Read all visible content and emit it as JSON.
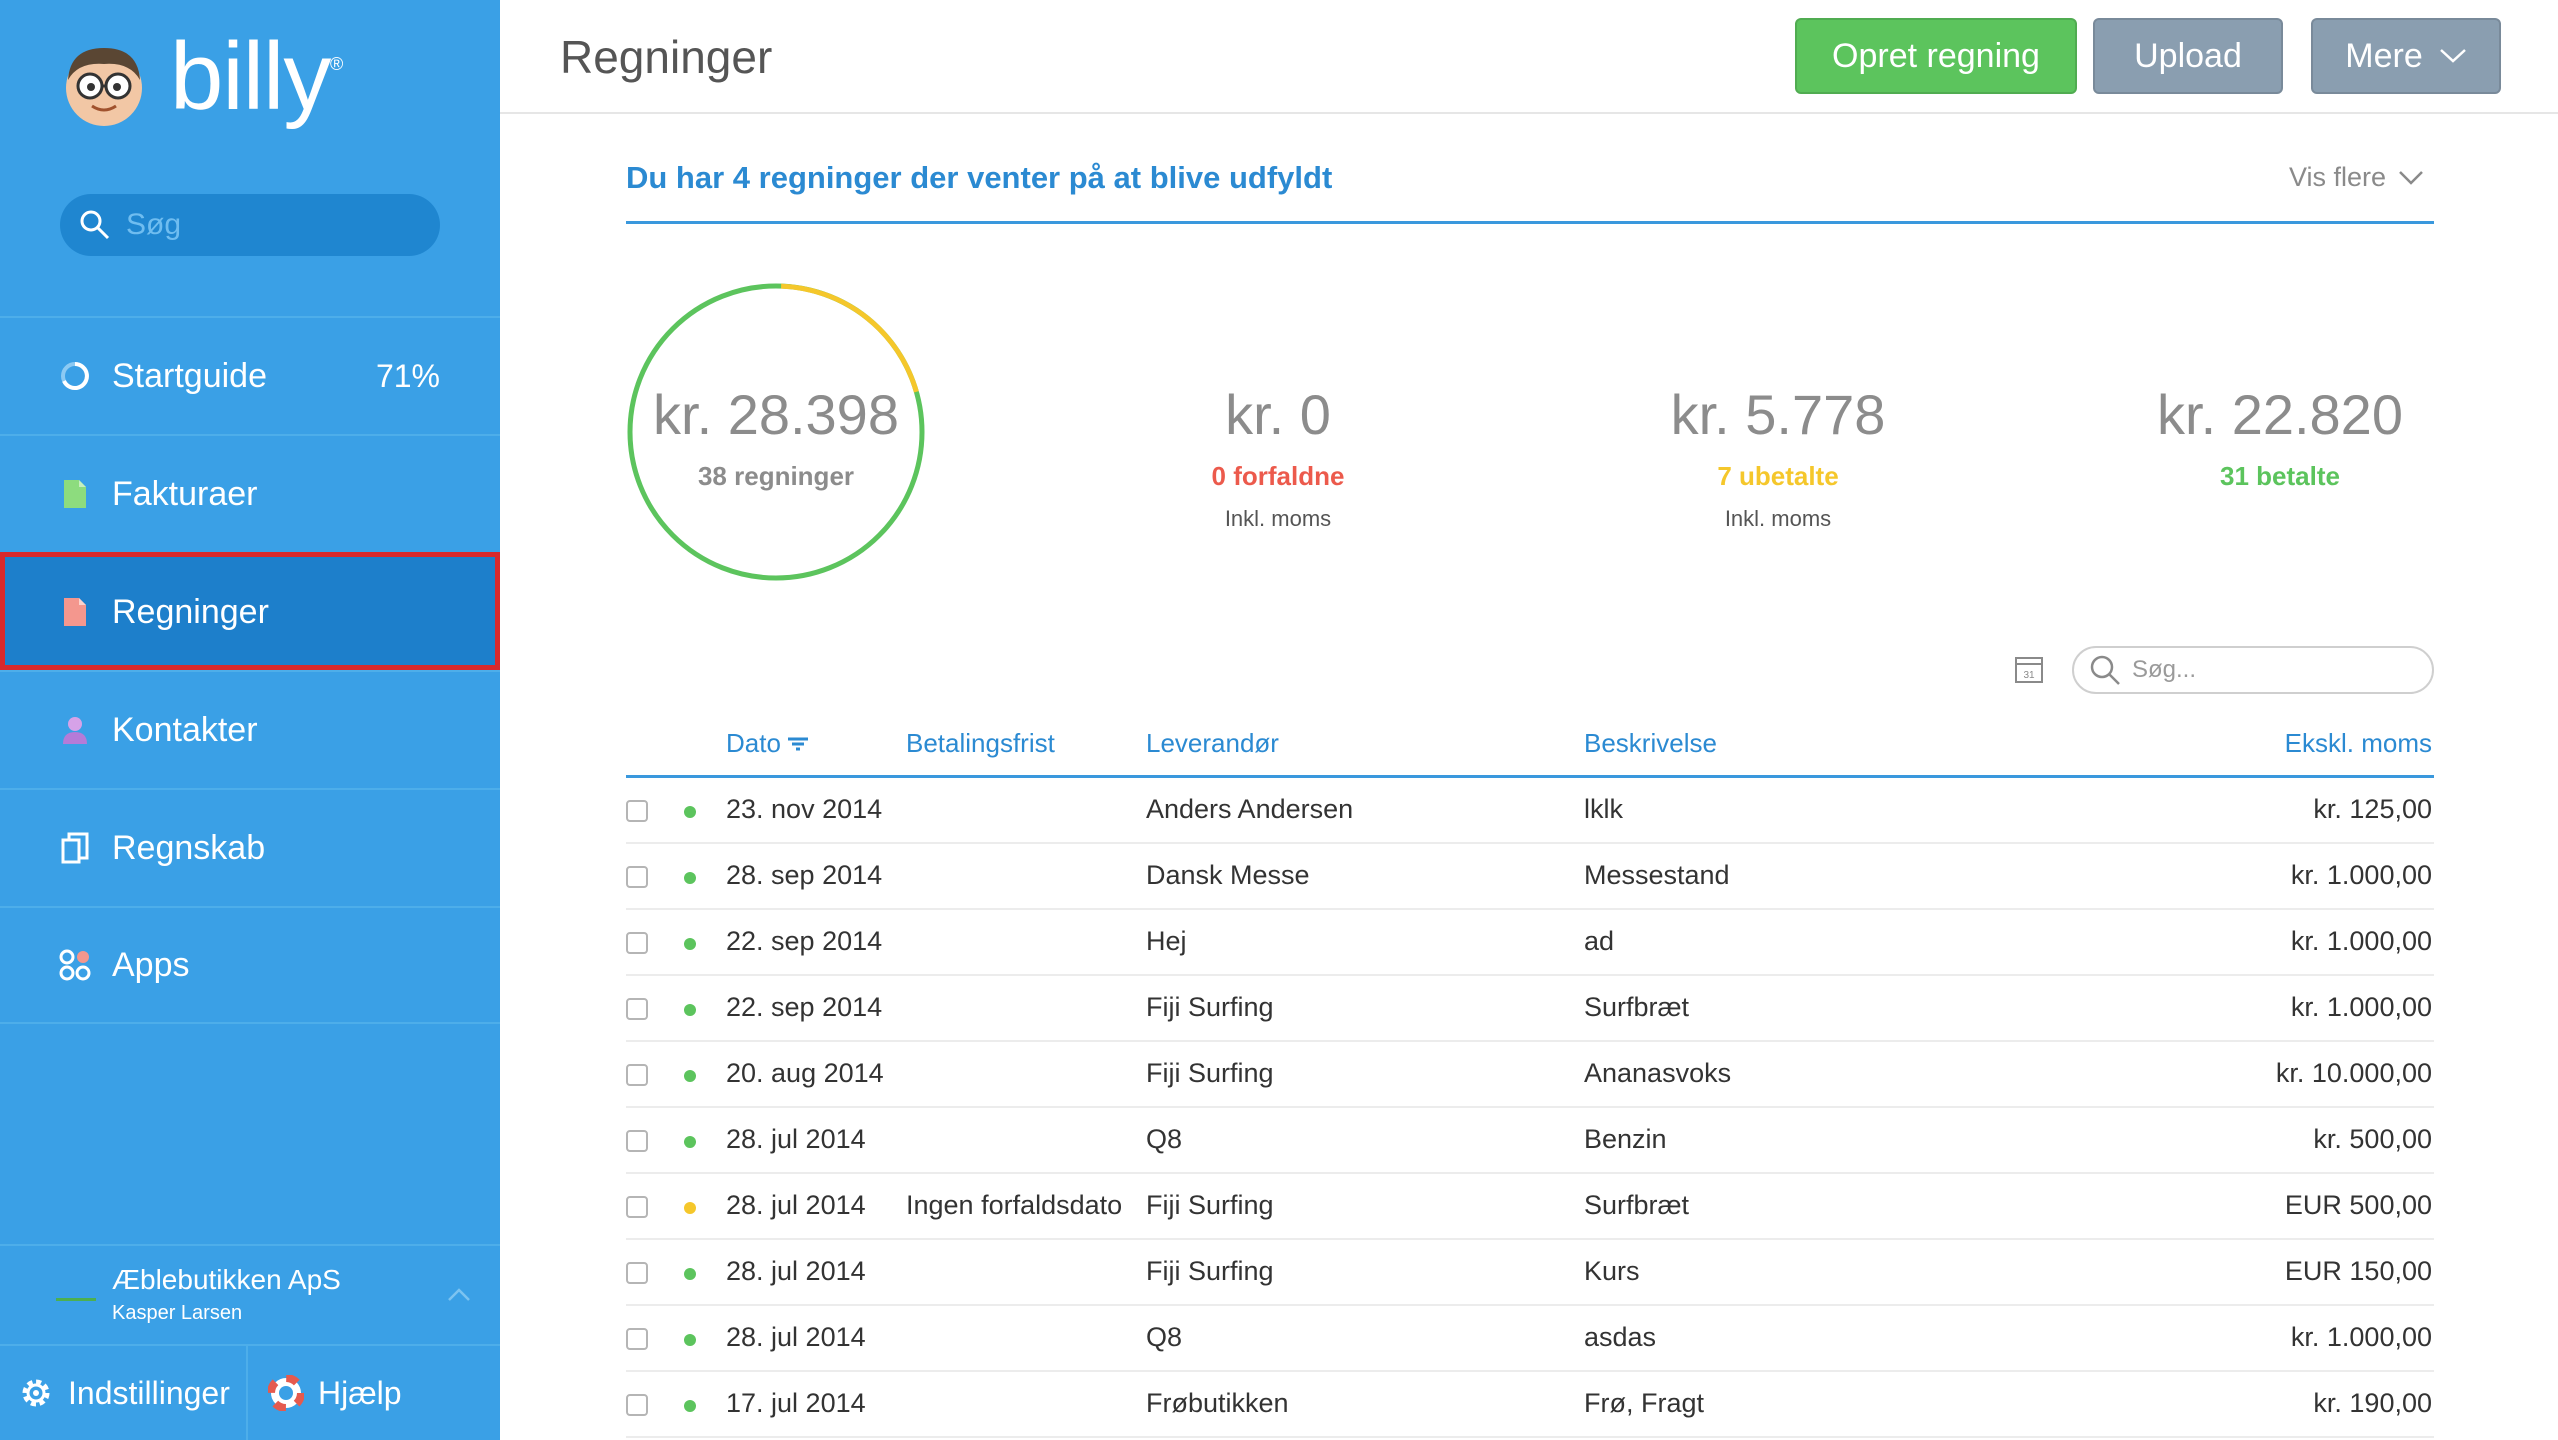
{
  "sidebar": {
    "logo_text": "billy",
    "logo_reg": "®",
    "search_placeholder": "Søg",
    "items": [
      {
        "label": "Startguide",
        "extra": "71%"
      },
      {
        "label": "Fakturaer"
      },
      {
        "label": "Regninger"
      },
      {
        "label": "Kontakter"
      },
      {
        "label": "Regnskab"
      },
      {
        "label": "Apps"
      }
    ],
    "company": {
      "name": "Æblebutikken ApS",
      "user": "Kasper Larsen"
    },
    "settings_label": "Indstillinger",
    "help_label": "Hjælp"
  },
  "header": {
    "title": "Regninger",
    "create_label": "Opret regning",
    "upload_label": "Upload",
    "more_label": "Mere"
  },
  "banner": {
    "text": "Du har 4 regninger der venter på at blive udfyldt",
    "more_label": "Vis flere"
  },
  "summary": {
    "total": {
      "amount": "kr. 28.398",
      "label": "38 regninger"
    },
    "overdue": {
      "amount": "kr. 0",
      "label": "0 forfaldne",
      "sub": "Inkl. moms",
      "color": "#ec5a4c"
    },
    "unpaid": {
      "amount": "kr. 5.778",
      "label": "7 ubetalte",
      "sub": "Inkl. moms",
      "color": "#f5c72b"
    },
    "paid": {
      "amount": "kr. 22.820",
      "label": "31 betalte",
      "color": "#5cc45d"
    },
    "ring_fraction_unpaid": 0.2
  },
  "table": {
    "search_placeholder": "Søg...",
    "calendar_label": "31",
    "columns": [
      "Dato",
      "Betalingsfrist",
      "Leverandør",
      "Beskrivelse",
      "Ekskl. moms"
    ],
    "rows": [
      {
        "status": "green",
        "dato": "23. nov 2014",
        "frist": "",
        "lev": "Anders Andersen",
        "besk": "lklk",
        "amt": "kr. 125,00"
      },
      {
        "status": "green",
        "dato": "28. sep 2014",
        "frist": "",
        "lev": "Dansk Messe",
        "besk": "Messestand",
        "amt": "kr. 1.000,00"
      },
      {
        "status": "green",
        "dato": "22. sep 2014",
        "frist": "",
        "lev": "Hej",
        "besk": "ad",
        "amt": "kr. 1.000,00"
      },
      {
        "status": "green",
        "dato": "22. sep 2014",
        "frist": "",
        "lev": "Fiji Surfing",
        "besk": "Surfbræt",
        "amt": "kr. 1.000,00"
      },
      {
        "status": "green",
        "dato": "20. aug 2014",
        "frist": "",
        "lev": "Fiji Surfing",
        "besk": "Ananasvoks",
        "amt": "kr. 10.000,00"
      },
      {
        "status": "green",
        "dato": "28. jul 2014",
        "frist": "",
        "lev": "Q8",
        "besk": "Benzin",
        "amt": "kr. 500,00"
      },
      {
        "status": "yellow",
        "dato": "28. jul 2014",
        "frist": "Ingen forfaldsdato",
        "lev": "Fiji Surfing",
        "besk": "Surfbræt",
        "amt": "EUR 500,00"
      },
      {
        "status": "green",
        "dato": "28. jul 2014",
        "frist": "",
        "lev": "Fiji Surfing",
        "besk": "Kurs",
        "amt": "EUR 150,00"
      },
      {
        "status": "green",
        "dato": "28. jul 2014",
        "frist": "",
        "lev": "Q8",
        "besk": "asdas",
        "amt": "kr. 1.000,00"
      },
      {
        "status": "green",
        "dato": "17. jul 2014",
        "frist": "",
        "lev": "Frøbutikken",
        "besk": "Frø, Fragt",
        "amt": "kr. 190,00"
      }
    ]
  },
  "colors": {
    "sidebar": "#3aa0e6",
    "sidebar_active": "#1d7fcb",
    "accent": "#2b8ad2",
    "green": "#5cc45d",
    "yellow": "#f5c72b",
    "red": "#ec5a4c"
  }
}
